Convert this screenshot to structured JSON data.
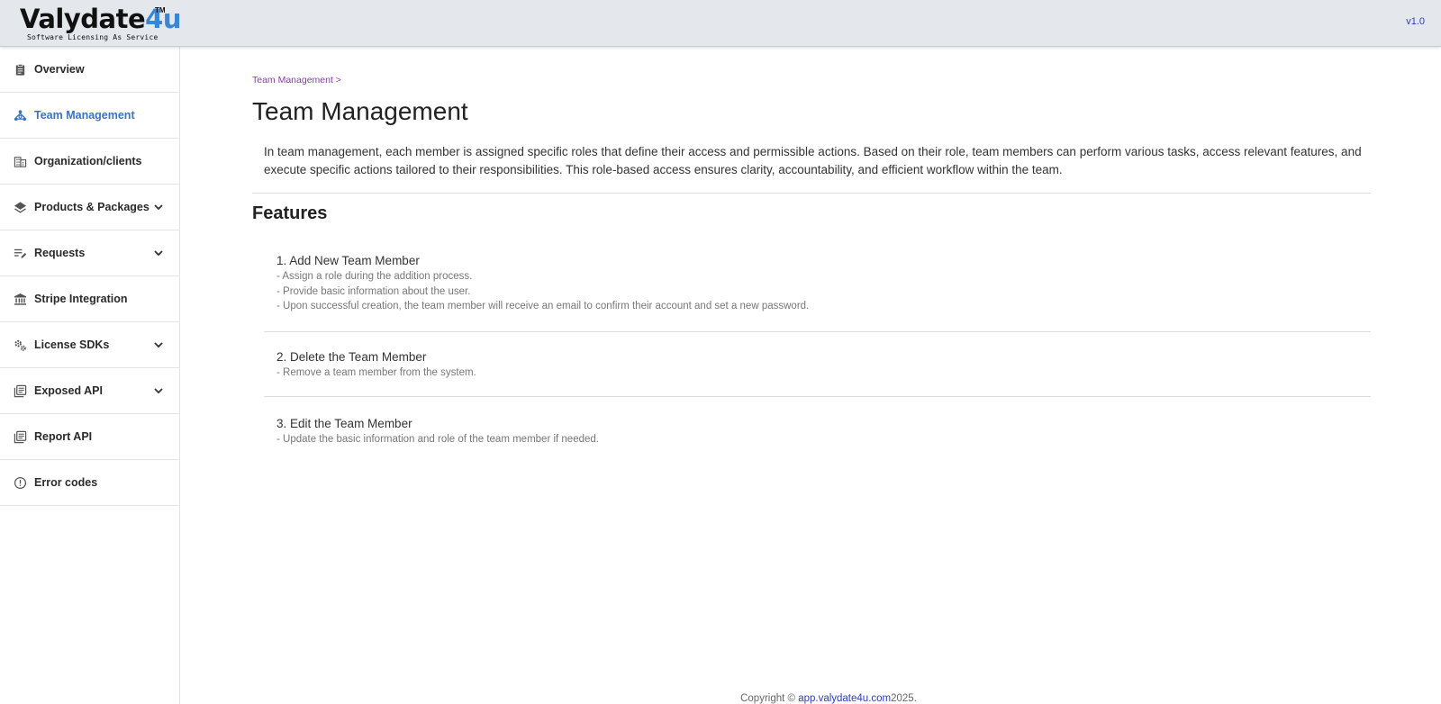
{
  "header": {
    "logo_prefix": "Valydate",
    "logo_accent": "4u",
    "logo_tm": "TM",
    "tagline": "Software Licensing As Service",
    "version": "v1.0"
  },
  "sidebar": {
    "items": [
      {
        "label": "Overview",
        "icon": "clipboard-icon"
      },
      {
        "label": "Team Management",
        "icon": "team-icon",
        "active": true
      },
      {
        "label": "Organization/clients",
        "icon": "building-icon"
      },
      {
        "label": "Products & Packages",
        "icon": "layers-icon",
        "expandable": true
      },
      {
        "label": "Requests",
        "icon": "edit-list-icon",
        "expandable": true
      },
      {
        "label": "Stripe Integration",
        "icon": "bank-icon"
      },
      {
        "label": "License SDKs",
        "icon": "gears-icon",
        "expandable": true
      },
      {
        "label": "Exposed API",
        "icon": "library-books-icon",
        "expandable": true
      },
      {
        "label": "Report API",
        "icon": "library-books-icon"
      },
      {
        "label": "Error codes",
        "icon": "error-circle-icon"
      }
    ]
  },
  "main": {
    "breadcrumb": "Team Management >",
    "title": "Team Management",
    "intro": "In team management, each member is assigned specific roles that define their access and permissible actions. Based on their role, team members can perform various tasks, access relevant features, and execute specific actions tailored to their responsibilities. This role-based access ensures clarity, accountability, and efficient workflow within the team.",
    "features_title": "Features",
    "features": [
      {
        "title": "1. Add New Team Member",
        "details": [
          "- Assign a role during the addition process.",
          "- Provide basic information about the user.",
          "- Upon successful creation, the team member will receive an email to confirm their account and set a new password."
        ]
      },
      {
        "title": "2. Delete the Team Member",
        "details": [
          "- Remove a team member from the system."
        ]
      },
      {
        "title": "3. Edit the Team Member",
        "details": [
          "- Update the basic information and role of the team member if needed."
        ]
      }
    ]
  },
  "footer": {
    "prefix": "Copyright © ",
    "link": "app.valydate4u.com",
    "suffix": "2025."
  },
  "colors": {
    "accent": "#3a73c4",
    "breadcrumb": "#8a3bb3",
    "link": "#2b3fb5",
    "topbar": "#e4e7ec"
  }
}
